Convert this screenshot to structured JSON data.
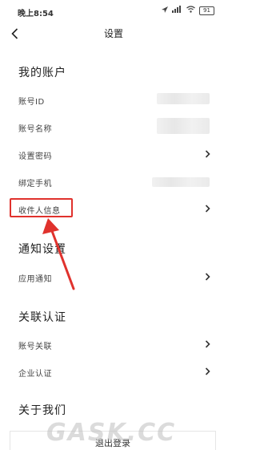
{
  "status_bar": {
    "time": "晚上8:54",
    "battery": "91"
  },
  "nav": {
    "title": "设置"
  },
  "sections": {
    "account": {
      "title": "我的账户",
      "rows": [
        {
          "label": "账号ID"
        },
        {
          "label": "账号名称"
        },
        {
          "label": "设置密码"
        },
        {
          "label": "绑定手机"
        },
        {
          "label": "收件人信息"
        }
      ]
    },
    "notification": {
      "title": "通知设置",
      "rows": [
        {
          "label": "应用通知"
        }
      ]
    },
    "verification": {
      "title": "关联认证",
      "rows": [
        {
          "label": "账号关联"
        },
        {
          "label": "企业认证"
        }
      ]
    },
    "about": {
      "title": "关于我们"
    }
  },
  "logout": {
    "label": "退出登录"
  },
  "watermark": "GASK.CC",
  "colors": {
    "highlight": "#e0322d",
    "arrow": "#e0322d",
    "background": "#ffffff"
  }
}
